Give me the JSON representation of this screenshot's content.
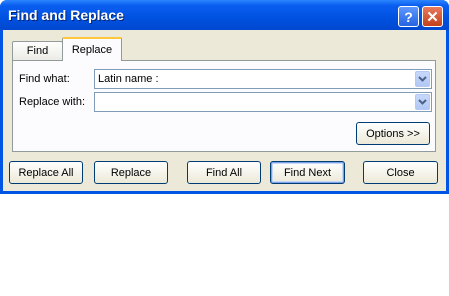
{
  "window": {
    "title": "Find and Replace"
  },
  "titlebar": {
    "help_glyph": "?",
    "close_glyph": "✕"
  },
  "tabs": [
    {
      "label": "Find",
      "selected": false
    },
    {
      "label": "Replace",
      "selected": true
    }
  ],
  "find": {
    "label": "Find what:",
    "value": "Latin name :"
  },
  "replace": {
    "label": "Replace with:",
    "value": ""
  },
  "buttons": {
    "options": "Options >>",
    "replace_all": "Replace All",
    "replace": "Replace",
    "find_all": "Find All",
    "find_next": "Find Next",
    "close": "Close"
  },
  "icons": {
    "dropdown": "chevron-down-icon",
    "help": "question-icon",
    "close": "close-icon"
  },
  "colors": {
    "title_bar": "#0055e5",
    "dialog_bg": "#ece9d8",
    "panel_bg": "#fcfcfe",
    "active_tab_accent": "#ffc83c",
    "close_button": "#c4401b"
  }
}
